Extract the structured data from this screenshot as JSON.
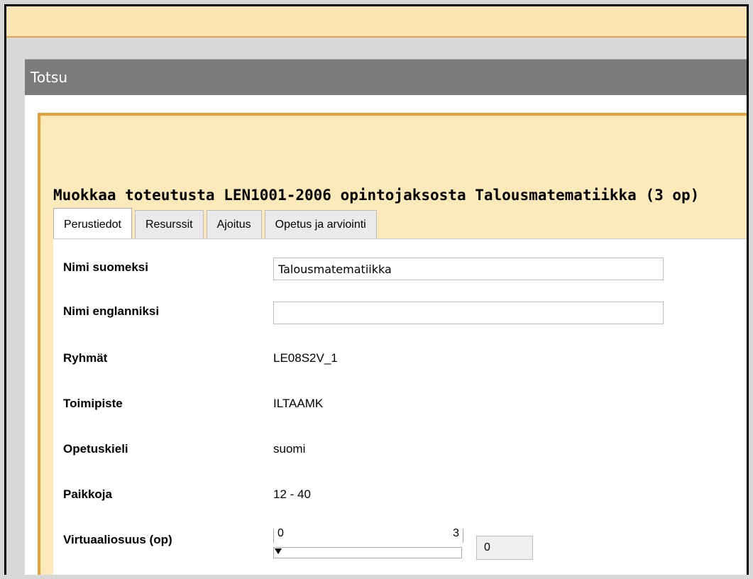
{
  "window": {
    "title": "Totsu"
  },
  "panel": {
    "heading": "Muokkaa toteutusta LEN1001-2006 opintojaksosta Talousmatematiikka (3 op)",
    "tabs": [
      {
        "label": "Perustiedot",
        "active": true
      },
      {
        "label": "Resurssit",
        "active": false
      },
      {
        "label": "Ajoitus",
        "active": false
      },
      {
        "label": "Opetus ja arviointi",
        "active": false
      }
    ]
  },
  "form": {
    "name_fi": {
      "label": "Nimi suomeksi",
      "value": "Talousmatematiikka"
    },
    "name_en": {
      "label": "Nimi englanniksi",
      "value": ""
    },
    "groups": {
      "label": "Ryhmät",
      "value": "LE08S2V_1"
    },
    "location": {
      "label": "Toimipiste",
      "value": "ILTAAMK"
    },
    "language": {
      "label": "Opetuskieli",
      "value": "suomi"
    },
    "seats": {
      "label": "Paikkoja",
      "value": "12 - 40"
    },
    "virtual": {
      "label": "Virtuaaliosuus (op)",
      "slider_min": "0",
      "slider_max": "3",
      "value": "0"
    }
  },
  "colors": {
    "accent_orange": "#e8a035",
    "panel_bg": "#fde9b9",
    "titlebar_gray": "#7c7c7c"
  }
}
